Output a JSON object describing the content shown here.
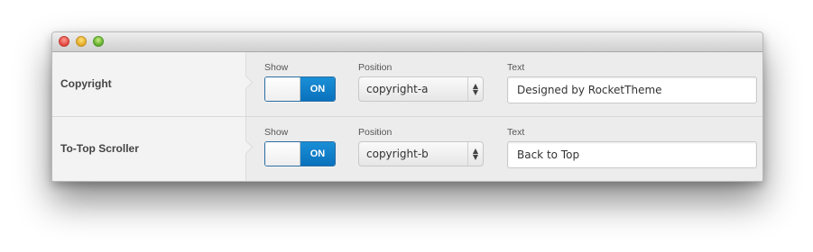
{
  "window": {
    "controls": [
      "close-button",
      "minimize-button",
      "zoom-button"
    ]
  },
  "rows": [
    {
      "label": "Copyright",
      "show_label": "Show",
      "toggle": {
        "on_text": "ON",
        "state": "on"
      },
      "position_label": "Position",
      "position_value": "copyright-a",
      "text_label": "Text",
      "text_value": "Designed by RocketTheme"
    },
    {
      "label": "To-Top Scroller",
      "show_label": "Show",
      "toggle": {
        "on_text": "ON",
        "state": "on"
      },
      "position_label": "Position",
      "position_value": "copyright-b",
      "text_label": "Text",
      "text_value": "Back to Top"
    }
  ],
  "colors": {
    "toggle_on": "#0a71bd",
    "close": "#e0443b",
    "minimize": "#e0a823",
    "zoom": "#5faa2b"
  }
}
